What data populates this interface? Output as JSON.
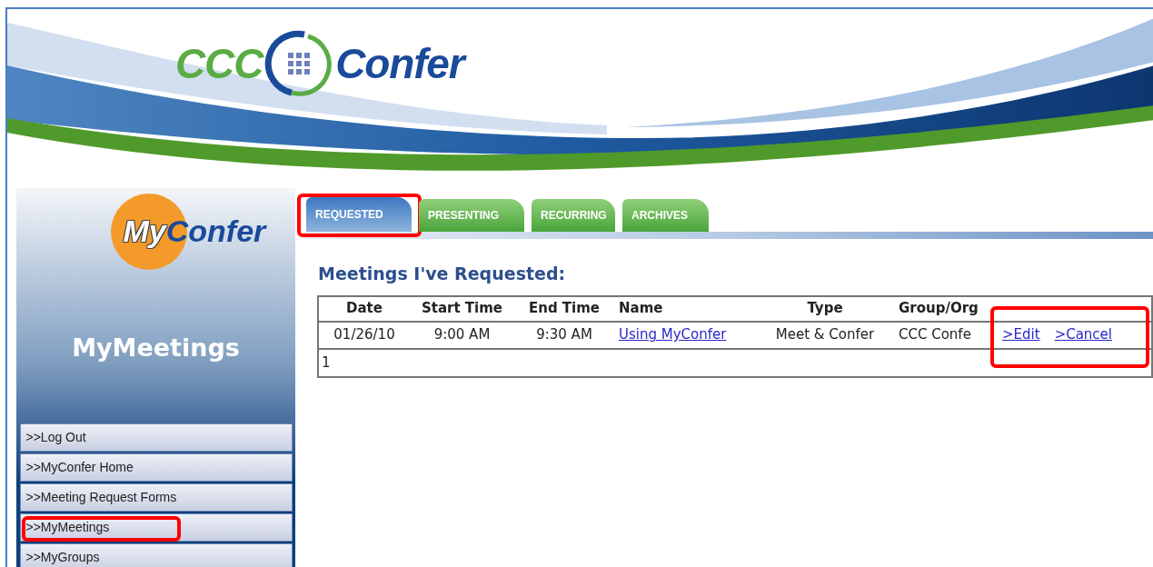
{
  "logo": {
    "part_1": "CCC",
    "part_2": "Confer"
  },
  "sidebar": {
    "logo": {
      "part_1": "My",
      "part_2": "Confer"
    },
    "title": "MyMeetings",
    "menu": [
      {
        "label": ">>Log Out",
        "highlighted": false
      },
      {
        "label": ">>MyConfer Home",
        "highlighted": false
      },
      {
        "label": ">>Meeting Request Forms",
        "highlighted": false
      },
      {
        "label": ">>MyMeetings",
        "highlighted": true
      },
      {
        "label": ">>MyGroups",
        "highlighted": false
      }
    ]
  },
  "tabs": [
    {
      "label": "REQUESTED",
      "selected": true,
      "highlighted": true
    },
    {
      "label": "PRESENTING",
      "selected": false,
      "highlighted": false
    },
    {
      "label": "RECURRING",
      "selected": false,
      "highlighted": false
    },
    {
      "label": "ARCHIVES",
      "selected": false,
      "highlighted": false
    }
  ],
  "heading": "Meetings I've Requested:",
  "table": {
    "columns": [
      "Date",
      "Start Time",
      "End Time",
      "Name",
      "Type",
      "Group/Org"
    ],
    "rows": [
      {
        "date": "01/26/10",
        "start_time": "9:00 AM",
        "end_time": "9:30 AM",
        "name": "Using MyConfer",
        "type": "Meet & Confer",
        "group_org": "CCC Confe",
        "actions": [
          ">Edit",
          ">Cancel"
        ],
        "actions_highlighted": true
      }
    ],
    "footer": "1"
  }
}
